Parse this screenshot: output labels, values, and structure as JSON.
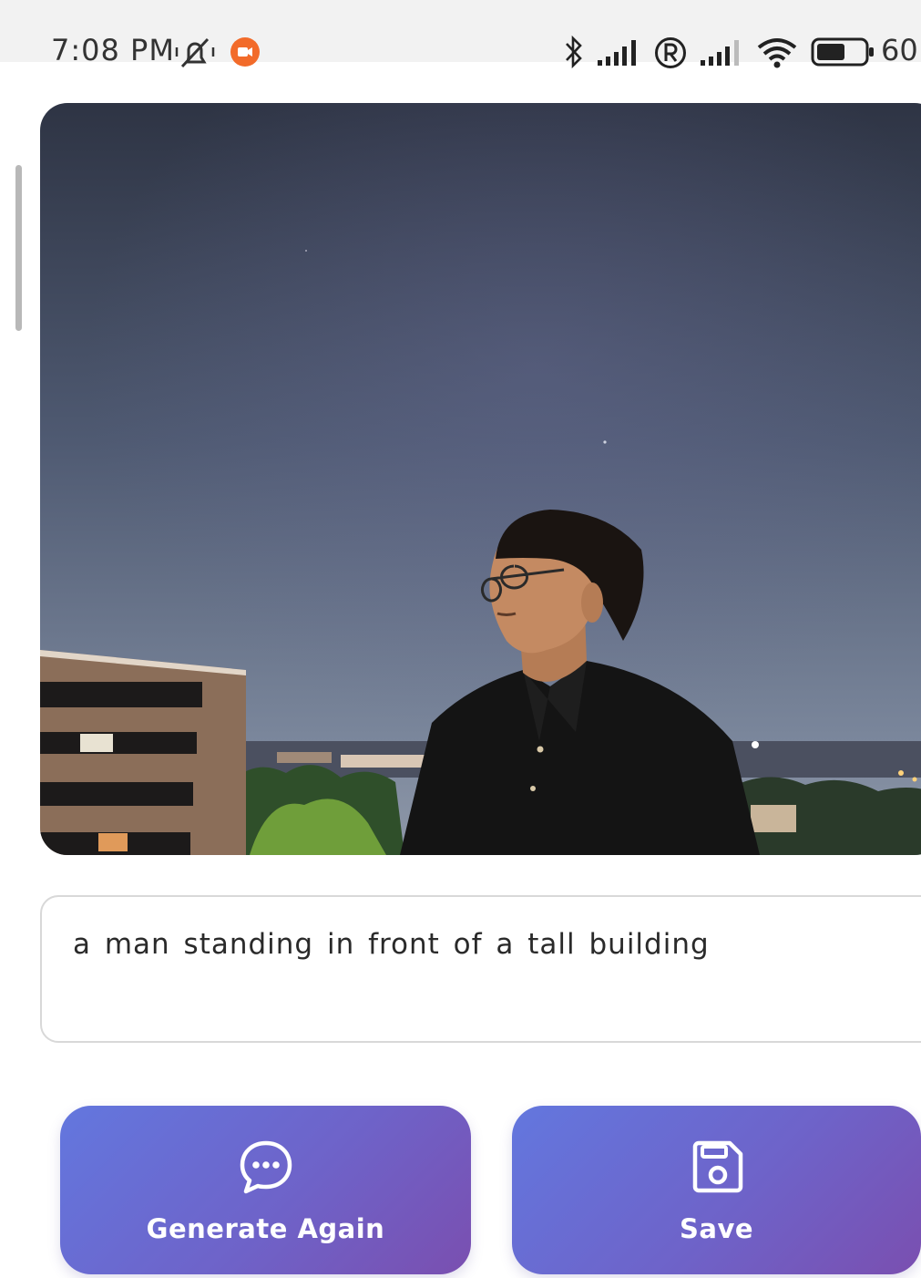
{
  "status_bar": {
    "time": "7:08 PM",
    "battery_text": "60",
    "icons": [
      "mute-icon",
      "screen-record-icon",
      "bluetooth-icon",
      "signal-icon",
      "registered-icon",
      "signal-icon",
      "wifi-icon",
      "battery-icon"
    ],
    "battery_level_percent": 60
  },
  "photo": {
    "subject": "night-portrait",
    "colors": {
      "sky_top": "#2f3646",
      "sky_bottom": "#6f7b92",
      "shirt": "#1a1a1a",
      "building": "#8b6e59"
    }
  },
  "caption": {
    "text": "a man standing in front of a tall building"
  },
  "actions": {
    "generate_label": "Generate Again",
    "generate_icon": "chat-bubble-icon",
    "save_label": "Save",
    "save_icon": "floppy-disk-icon",
    "gradient": {
      "start": "#6377de",
      "end": "#7a4fb0"
    }
  }
}
